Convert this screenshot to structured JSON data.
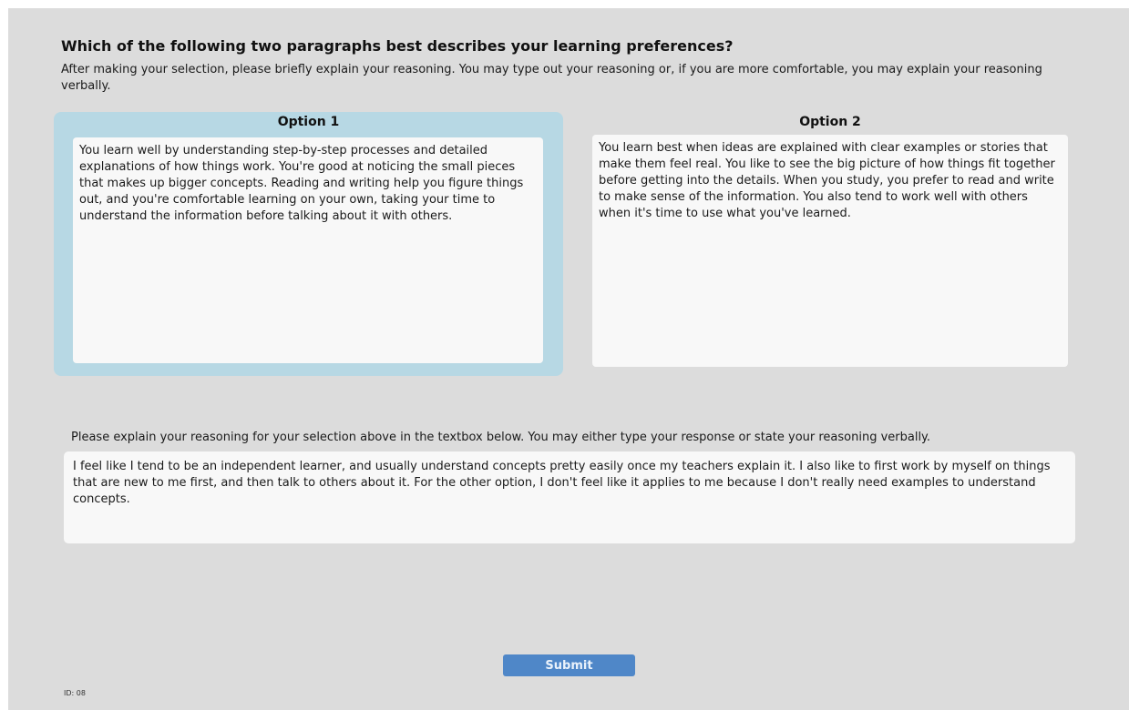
{
  "header": {
    "question": "Which of the following two paragraphs best describes your learning preferences?",
    "instructions": "After making your selection, please briefly explain your reasoning. You may type out your reasoning or, if you are more comfortable, you may explain your reasoning verbally."
  },
  "options": [
    {
      "label": "Option 1",
      "text": "You learn well by understanding step-by-step processes and detailed explanations of how things work. You're good at noticing the small pieces that makes up bigger concepts. Reading and writing help you figure things out, and you're comfortable learning on your own, taking your time to understand the information before talking about it with others.",
      "selected": true
    },
    {
      "label": "Option 2",
      "text": "You learn best when ideas are explained with clear examples or stories that make them feel real. You like to see the big picture of how things fit together before getting into the details. When you study, you prefer to read and write to make sense of the information. You also tend to work well with others when it's time to use what you've learned.",
      "selected": false
    }
  ],
  "response": {
    "prompt": "Please explain your reasoning for your selection above in the textbox below. You may either type your response or state your reasoning verbally.",
    "value": "I feel like I tend to be an independent learner, and usually understand concepts pretty easily once my teachers explain it. I also like to first work by myself on things that are new to me first, and then talk to others about it. For the other option, I don't feel like it applies to me because I don't really need examples to understand concepts."
  },
  "submit_label": "Submit",
  "id_label": "ID: 08",
  "colors": {
    "background": "#dcdcdc",
    "selected_option": "#b7d8e4",
    "submit_button": "#4f87c8"
  }
}
